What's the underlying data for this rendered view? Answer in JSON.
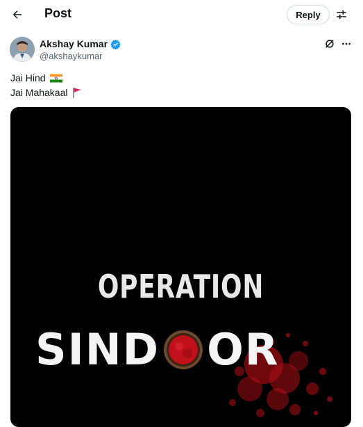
{
  "header": {
    "title": "Post",
    "reply_label": "Reply"
  },
  "post": {
    "author_name": "Akshay Kumar",
    "author_handle": "@akshaykumar",
    "lines": [
      "Jai Hind",
      "Jai Mahakaal"
    ]
  },
  "media": {
    "line_top": "OPERATION",
    "line_bottom_left": "SIND",
    "line_bottom_right": "OR"
  },
  "colors": {
    "verified": "#1d9bf0",
    "sindoor_red": "#c0101a",
    "flag_saffron": "#ff9933",
    "flag_green": "#138808"
  },
  "icons": [
    "back-arrow-icon",
    "adjust-icon",
    "verified-badge-icon",
    "grok-icon",
    "more-icon",
    "indian-flag-emoji",
    "red-flag-emoji"
  ]
}
